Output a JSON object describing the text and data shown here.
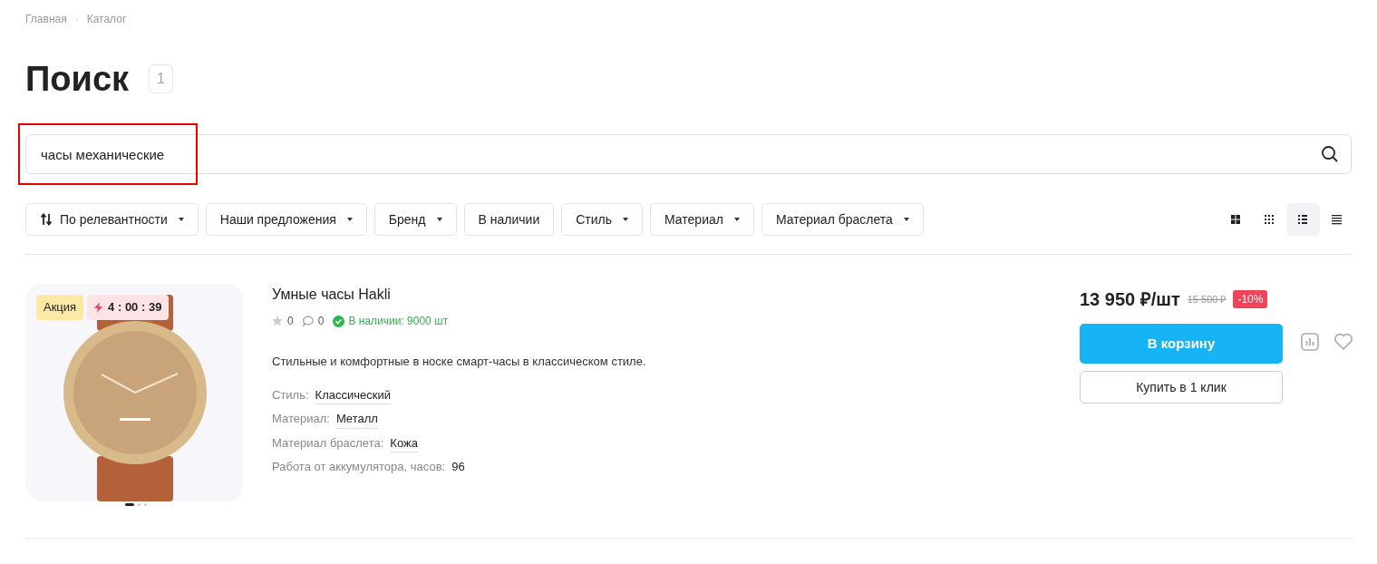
{
  "breadcrumbs": [
    {
      "label": "Главная"
    },
    {
      "label": "Каталог"
    }
  ],
  "breadcrumb_separator": "·",
  "title": "Поиск",
  "count": "1",
  "search": {
    "value": "часы механические",
    "highlighted": true
  },
  "filters": [
    {
      "label": "По релевантности",
      "kind": "sort",
      "dropdown": true
    },
    {
      "label": "Наши предложения",
      "kind": "filter",
      "dropdown": true
    },
    {
      "label": "Бренд",
      "kind": "filter",
      "dropdown": true
    },
    {
      "label": "В наличии",
      "kind": "filter",
      "dropdown": false
    },
    {
      "label": "Стиль",
      "kind": "filter",
      "dropdown": true
    },
    {
      "label": "Материал",
      "kind": "filter",
      "dropdown": true
    },
    {
      "label": "Материал браслета",
      "kind": "filter",
      "dropdown": true
    }
  ],
  "view_modes": [
    {
      "kind": "tiles",
      "selected": false
    },
    {
      "kind": "grid",
      "selected": false
    },
    {
      "kind": "list",
      "selected": true
    },
    {
      "kind": "lines",
      "selected": false
    }
  ],
  "products": [
    {
      "badge": "Акция",
      "timer": "4 : 00 : 39",
      "slides": [
        {
          "selected": true
        },
        {
          "selected": false
        },
        {
          "selected": false
        }
      ],
      "name": "Умные часы Hakli",
      "rating": "0",
      "reviews": "0",
      "stock": "В наличии: 9000 шт",
      "description": "Стильные и комфортные в носке смарт-часы в классическом стиле.",
      "properties": [
        {
          "label": "Стиль:",
          "value": "Классический",
          "kind": "link"
        },
        {
          "label": "Материал:",
          "value": "Металл",
          "kind": "link"
        },
        {
          "label": "Материал браслета:",
          "value": "Кожа",
          "kind": "link"
        },
        {
          "label": "Работа от аккумулятора, часов:",
          "value": "96",
          "kind": "text"
        }
      ],
      "price": "13 950 ₽/шт",
      "old_price": "15 500 ₽",
      "discount": "-10%",
      "cart_button": "В корзину",
      "quick_buy_button": "Купить в 1 клик"
    }
  ]
}
